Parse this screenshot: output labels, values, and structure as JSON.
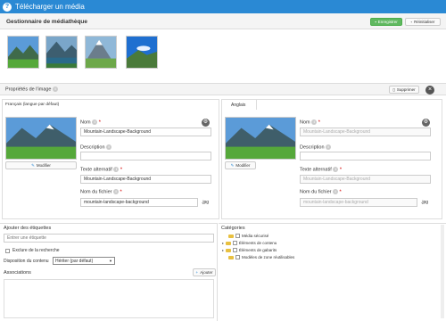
{
  "window": {
    "title": "Télécharger un média"
  },
  "header": {
    "title": "Gestionnaire de médiathèque",
    "save_label": "Enregistrer",
    "reset_label": "Réinitialiser"
  },
  "thumbnails": [
    {
      "name": "mountain-green-meadow"
    },
    {
      "name": "mountain-lake"
    },
    {
      "name": "mountain-peak-snow"
    },
    {
      "name": "mountain-sky-blue"
    }
  ],
  "properties": {
    "title": "Propriétés de l'image",
    "delete_label": "Supprimer"
  },
  "tabs": {
    "french": "Français (langue par défaut)",
    "english": "Anglais"
  },
  "fr": {
    "edit_label": "Modifier",
    "name_label": "Nom",
    "name_value": "Mountain-Landscape-Background",
    "description_label": "Description",
    "description_value": "",
    "alt_label": "Texte alternatif",
    "alt_value": "Mountain-Landscape-Background",
    "filename_label": "Nom du fichier",
    "filename_value": "mountain-landscape-background",
    "ext": ".jpg"
  },
  "en": {
    "edit_label": "Modifier",
    "name_label": "Nom",
    "name_placeholder": "Mountain-Landscape-Background",
    "description_label": "Description",
    "alt_label": "Texte alternatif",
    "alt_placeholder": "Mountain-Landscape-Background",
    "filename_label": "Nom du fichier",
    "filename_placeholder": "mountain-landscape-background",
    "ext": ".jpg"
  },
  "tags": {
    "title": "Ajouter des étiquettes",
    "placeholder": "Entrer une étiquette",
    "exclude_label": "Exclure de la recherche"
  },
  "display": {
    "label": "Disposition du contenu",
    "selected": "Hériter (par défaut)"
  },
  "associations": {
    "title": "Associations",
    "add_label": "Ajouter"
  },
  "categories": {
    "title": "Catégories",
    "items": [
      "Média sécurisé",
      "Éléments de contenu",
      "Éléments de gabarits",
      "Modèles de zone réutilisables"
    ]
  },
  "colors": {
    "titlebar": "#2a89d4",
    "save": "#5fb85f"
  }
}
